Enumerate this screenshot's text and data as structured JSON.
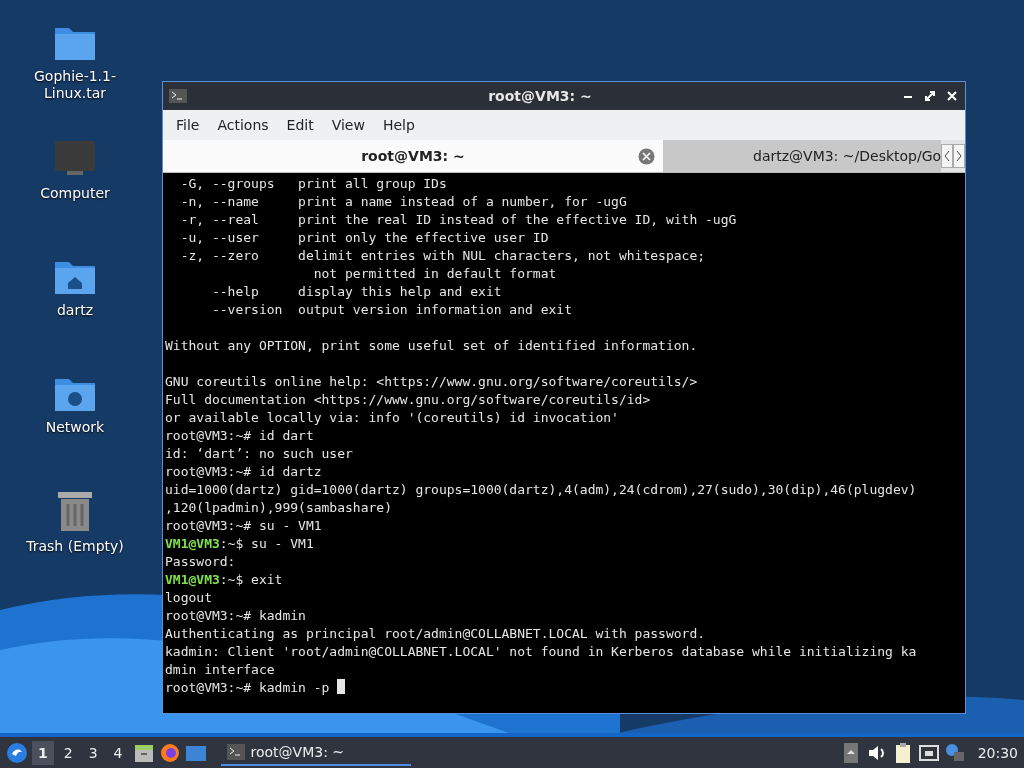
{
  "desktop_icons": [
    {
      "kind": "folder",
      "label": "Gophie-1.1-\nLinux.tar"
    },
    {
      "kind": "computer",
      "label": "Computer"
    },
    {
      "kind": "home",
      "label": "dartz"
    },
    {
      "kind": "network",
      "label": "Network"
    },
    {
      "kind": "trash",
      "label": "Trash (Empty)"
    }
  ],
  "window": {
    "title": "root@VM3: ~",
    "menu": [
      "File",
      "Actions",
      "Edit",
      "View",
      "Help"
    ],
    "tabs": [
      {
        "label": "root@VM3: ~",
        "selected": true
      },
      {
        "label": "dartz@VM3: ~/Desktop/Go",
        "selected": false
      }
    ],
    "terminal": {
      "cursor": true,
      "lines": [
        {
          "kind": "text",
          "text": "  -G, --groups   print all group IDs"
        },
        {
          "kind": "text",
          "text": "  -n, --name     print a name instead of a number, for -ugG"
        },
        {
          "kind": "text",
          "text": "  -r, --real     print the real ID instead of the effective ID, with -ugG"
        },
        {
          "kind": "text",
          "text": "  -u, --user     print only the effective user ID"
        },
        {
          "kind": "text",
          "text": "  -z, --zero     delimit entries with NUL characters, not whitespace;"
        },
        {
          "kind": "text",
          "text": "                   not permitted in default format"
        },
        {
          "kind": "text",
          "text": "      --help     display this help and exit"
        },
        {
          "kind": "text",
          "text": "      --version  output version information and exit"
        },
        {
          "kind": "blank"
        },
        {
          "kind": "text",
          "text": "Without any OPTION, print some useful set of identified information."
        },
        {
          "kind": "blank"
        },
        {
          "kind": "text",
          "text": "GNU coreutils online help: <https://www.gnu.org/software/coreutils/>"
        },
        {
          "kind": "text",
          "text": "Full documentation <https://www.gnu.org/software/coreutils/id>"
        },
        {
          "kind": "text",
          "text": "or available locally via: info '(coreutils) id invocation'"
        },
        {
          "kind": "text",
          "text": "root@VM3:~# id dart"
        },
        {
          "kind": "text",
          "text": "id: ‘dart’: no such user"
        },
        {
          "kind": "text",
          "text": "root@VM3:~# id dartz"
        },
        {
          "kind": "text",
          "text": "uid=1000(dartz) gid=1000(dartz) groups=1000(dartz),4(adm),24(cdrom),27(sudo),30(dip),46(plugdev)"
        },
        {
          "kind": "text",
          "text": ",120(lpadmin),999(sambashare)"
        },
        {
          "kind": "text",
          "text": "root@VM3:~# su - VM1"
        },
        {
          "kind": "prompt",
          "user": "VM1@VM3",
          "rest": ":~$ su - VM1"
        },
        {
          "kind": "text",
          "text": "Password:"
        },
        {
          "kind": "prompt",
          "user": "VM1@VM3",
          "rest": ":~$ exit"
        },
        {
          "kind": "text",
          "text": "logout"
        },
        {
          "kind": "text",
          "text": "root@VM3:~# kadmin"
        },
        {
          "kind": "text",
          "text": "Authenticating as principal root/admin@COLLABNET.LOCAL with password."
        },
        {
          "kind": "text",
          "text": "kadmin: Client 'root/admin@COLLABNET.LOCAL' not found in Kerberos database while initializing ka"
        },
        {
          "kind": "text",
          "text": "dmin interface"
        },
        {
          "kind": "text",
          "text": "root@VM3:~# kadmin -p "
        }
      ]
    }
  },
  "taskbar": {
    "workspaces": [
      {
        "label": "1",
        "selected": true
      },
      {
        "label": "2",
        "selected": false
      },
      {
        "label": "3",
        "selected": false
      },
      {
        "label": "4",
        "selected": false
      }
    ],
    "task": {
      "label": "root@VM3: ~",
      "selected": true
    },
    "clock": "20:30"
  }
}
